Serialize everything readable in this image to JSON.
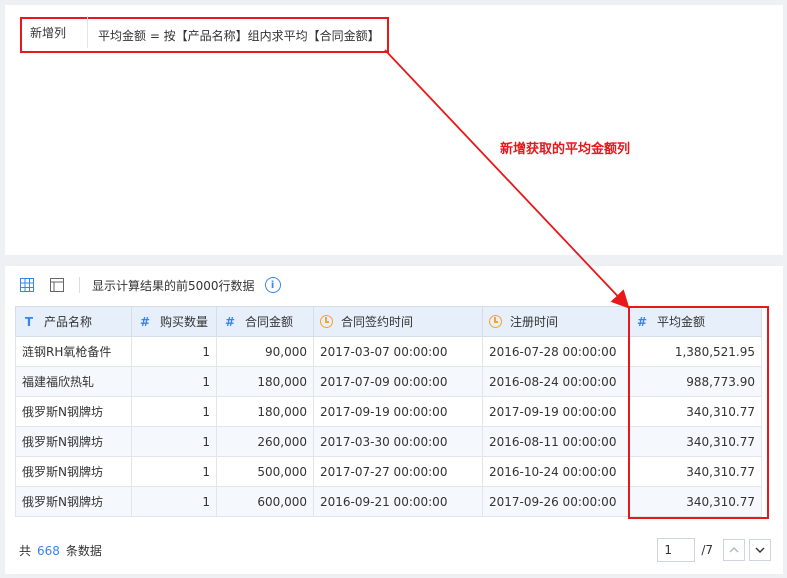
{
  "formula": {
    "name": "新增列",
    "expression": "平均金额 = 按【产品名称】组内求平均【合同金额】"
  },
  "annotation": "新增获取的平均金额列",
  "toolbar": {
    "info_text": "显示计算结果的前5000行数据",
    "icons": [
      "table-view-icon",
      "window-view-icon",
      "info-icon"
    ]
  },
  "table": {
    "columns": [
      {
        "label": "产品名称",
        "type": "T"
      },
      {
        "label": "购买数量",
        "type": "#"
      },
      {
        "label": "合同金额",
        "type": "#"
      },
      {
        "label": "合同签约时间",
        "type": "clock"
      },
      {
        "label": "注册时间",
        "type": "clock"
      },
      {
        "label": "平均金额",
        "type": "#"
      }
    ],
    "rows": [
      [
        "涟钢RH氧枪备件",
        "1",
        "90,000",
        "2017-03-07 00:00:00",
        "2016-07-28 00:00:00",
        "1,380,521.95"
      ],
      [
        "福建福欣热轧",
        "1",
        "180,000",
        "2017-07-09 00:00:00",
        "2016-08-24 00:00:00",
        "988,773.90"
      ],
      [
        "俄罗斯N钢牌坊",
        "1",
        "180,000",
        "2017-09-19 00:00:00",
        "2017-09-19 00:00:00",
        "340,310.77"
      ],
      [
        "俄罗斯N钢牌坊",
        "1",
        "260,000",
        "2017-03-30 00:00:00",
        "2016-08-11 00:00:00",
        "340,310.77"
      ],
      [
        "俄罗斯N钢牌坊",
        "1",
        "500,000",
        "2017-07-27 00:00:00",
        "2016-10-24 00:00:00",
        "340,310.77"
      ],
      [
        "俄罗斯N钢牌坊",
        "1",
        "600,000",
        "2016-09-21 00:00:00",
        "2017-09-26 00:00:00",
        "340,310.77"
      ]
    ]
  },
  "footer": {
    "prefix": "共",
    "count": "668",
    "suffix": "条数据"
  },
  "pager": {
    "current": "1",
    "total": "/7"
  },
  "colors": {
    "highlight": "#e8171a",
    "accent": "#3685f2",
    "header_bg": "#e7effa",
    "clock": "#f5a623"
  }
}
